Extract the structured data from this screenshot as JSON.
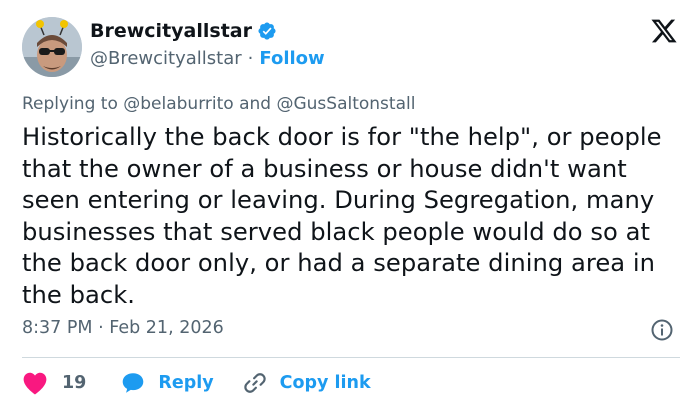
{
  "author": {
    "display_name": "Brewcityallstar",
    "handle": "@Brewcityallstar",
    "separator": "·",
    "follow_label": "Follow",
    "verified_color": "#1d9bf0"
  },
  "reply_to": {
    "prefix": "Replying to",
    "mention_1": "@belaburrito",
    "conjunction": "and",
    "mention_2": "@GusSaltonstall"
  },
  "tweet": {
    "text": "Historically the back door is for \"the help\", or people that the owner of a business or house didn't want seen entering or leaving. During Segregation, many businesses that served black people would do so at the back door only, or had a separate dining area in the back."
  },
  "meta": {
    "time": "8:37 PM",
    "separator": "·",
    "date": "Feb 21, 2026"
  },
  "actions": {
    "like_count": "19",
    "reply_label": "Reply",
    "copy_label": "Copy link"
  },
  "icons": {
    "brand": "x-logo-icon",
    "info": "info-icon",
    "like": "heart-icon",
    "reply": "speech-bubble-icon",
    "copy": "link-icon"
  },
  "colors": {
    "accent": "#1d9bf0",
    "like": "#f91880",
    "muted": "#536471",
    "text": "#0f1419"
  }
}
